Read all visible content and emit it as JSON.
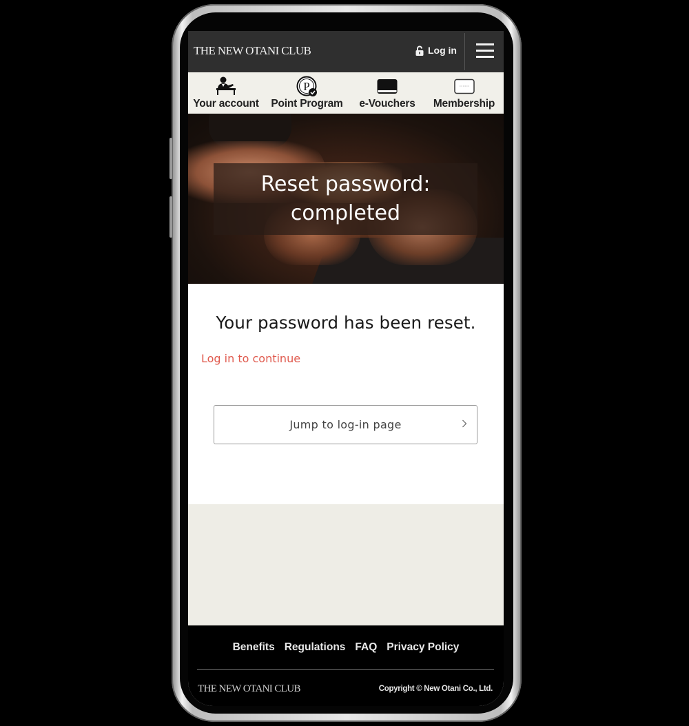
{
  "header": {
    "logo": "THE NEW OTANI CLUB",
    "login_label": "Log in",
    "login_icon": "unlock-icon",
    "menu_icon": "hamburger-menu-icon"
  },
  "nav": {
    "items": [
      {
        "label": "Your account",
        "icon": "account-desk-icon"
      },
      {
        "label": "Point Program",
        "icon": "point-coin-icon"
      },
      {
        "label": "e-Vouchers",
        "icon": "voucher-card-icon"
      },
      {
        "label": "Membership",
        "icon": "membership-card-icon"
      }
    ]
  },
  "hero": {
    "title_line1": "Reset password:",
    "title_line2": "completed"
  },
  "content": {
    "heading": "Your password has been reset.",
    "continue_link": "Log in to continue",
    "jump_button": "Jump to log-in page",
    "jump_chevron": "›"
  },
  "footer": {
    "links": [
      "Benefits",
      "Regulations",
      "FAQ",
      "Privacy Policy"
    ],
    "logo": "THE NEW OTANI CLUB",
    "copyright": "Copyright © New Otani Co., Ltd."
  },
  "colors": {
    "header_bg": "#2f2f2f",
    "nav_bg": "#f1f0ea",
    "link_red": "#e05a4e",
    "beige_bg": "#eeede6",
    "footer_bg": "#000000"
  }
}
